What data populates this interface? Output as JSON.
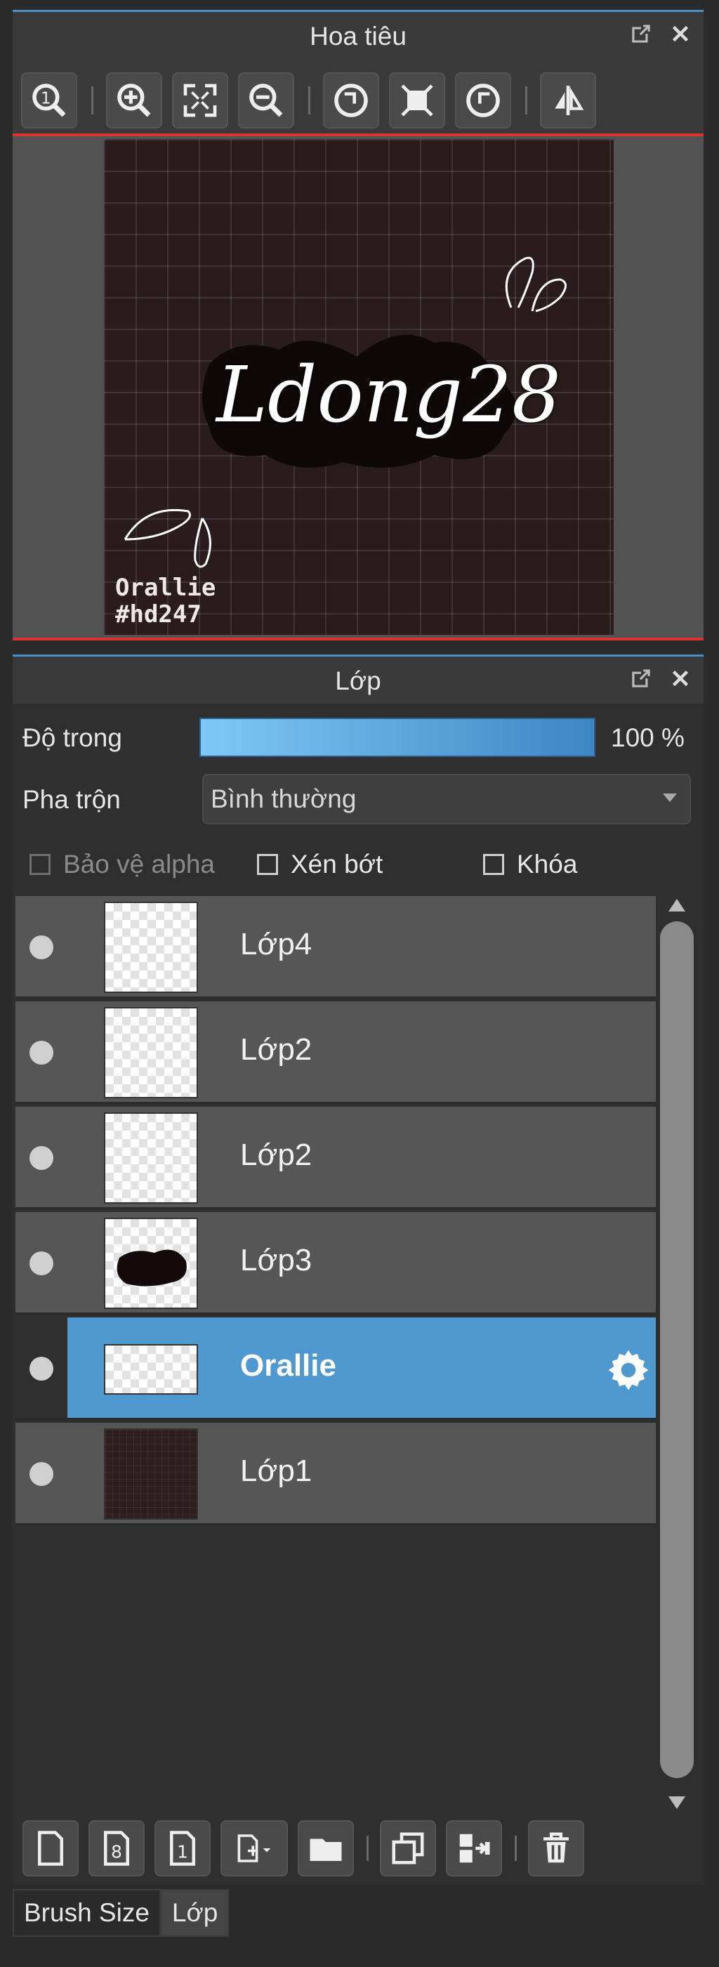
{
  "navigator": {
    "title": "Hoa tiêu",
    "toolbar": [
      "zoom-actual",
      "zoom-in",
      "fit",
      "zoom-out",
      "rotate-left",
      "fullscreen",
      "rotate-right",
      "flip"
    ],
    "canvas_text": "Ldong28",
    "signature_line1": "Orallie",
    "signature_line2": "#hd247"
  },
  "layers_panel": {
    "title": "Lớp",
    "opacity_label": "Độ trong",
    "opacity_value": "100 %",
    "opacity_fraction": 1.0,
    "blend_label": "Pha trộn",
    "blend_value": "Bình thường",
    "protect_alpha": "Bảo vệ alpha",
    "clipping": "Xén bớt",
    "lock": "Khóa",
    "layers": [
      {
        "name": "Lớp4"
      },
      {
        "name": "Lớp2"
      },
      {
        "name": "Lớp2"
      },
      {
        "name": "Lớp3"
      },
      {
        "name": "Orallie"
      },
      {
        "name": "Lớp1"
      }
    ]
  },
  "tabs": [
    "Brush Size",
    "Lớp"
  ],
  "colors": {
    "accent": "#4f98d0",
    "divider": "#dd3333"
  }
}
